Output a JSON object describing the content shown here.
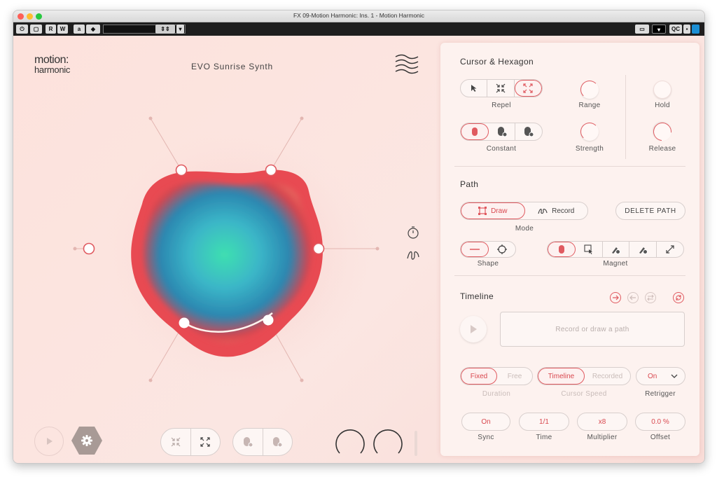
{
  "window": {
    "title": "FX 09-Motion Harmonic: Ins. 1 - Motion Harmonic"
  },
  "toolbar": {
    "r_label": "R",
    "w_label": "W",
    "a_label": "a",
    "qc_label": "QC"
  },
  "app": {
    "logo_line1": "motion:",
    "logo_line2": "harmonic",
    "preset_name": "EVO Sunrise Synth"
  },
  "cursor_hexagon": {
    "title": "Cursor & Hexagon",
    "repel_label": "Repel",
    "constant_label": "Constant",
    "range_label": "Range",
    "strength_label": "Strength",
    "hold_label": "Hold",
    "release_label": "Release"
  },
  "path": {
    "title": "Path",
    "draw_label": "Draw",
    "record_label": "Record",
    "delete_label": "DELETE PATH",
    "mode_label": "Mode",
    "shape_label": "Shape",
    "magnet_label": "Magnet"
  },
  "timeline": {
    "title": "Timeline",
    "placeholder": "Record or draw a path",
    "fixed_label": "Fixed",
    "free_label": "Free",
    "duration_label": "Duration",
    "timeline_label": "Timeline",
    "recorded_label": "Recorded",
    "cursor_speed_label": "Cursor Speed",
    "retrigger_value": "On",
    "retrigger_label": "Retrigger",
    "sync_value": "On",
    "sync_label": "Sync",
    "time_value": "1/1",
    "time_label": "Time",
    "multiplier_value": "x8",
    "multiplier_label": "Multiplier",
    "offset_value": "0.0 %",
    "offset_label": "Offset"
  },
  "colors": {
    "accent": "#e05a60",
    "background": "#fbe4df",
    "panel": "#fdf2ef"
  }
}
